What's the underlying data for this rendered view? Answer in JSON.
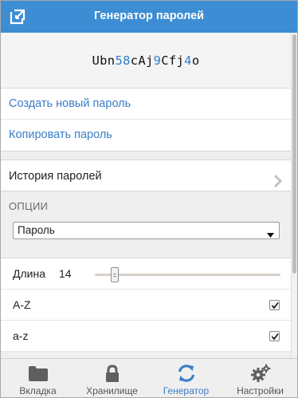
{
  "header": {
    "title": "Генератор паролей",
    "popout_icon": "popout-icon"
  },
  "password": {
    "parts": [
      {
        "text": "Ubn",
        "type": "char"
      },
      {
        "text": "58",
        "type": "digit"
      },
      {
        "text": "cAj",
        "type": "char"
      },
      {
        "text": "9",
        "type": "digit"
      },
      {
        "text": "Cfj",
        "type": "char"
      },
      {
        "text": "4",
        "type": "digit"
      },
      {
        "text": "o",
        "type": "char"
      }
    ],
    "digit_color": "#2f7ed0"
  },
  "actions": {
    "create": "Создать новый пароль",
    "copy": "Копировать пароль"
  },
  "history": {
    "label": "История паролей",
    "icon": "chevron-right-icon"
  },
  "options": {
    "heading": "ОПЦИИ",
    "type_select": {
      "value": "Пароль"
    },
    "length": {
      "label": "Длина",
      "value": "14",
      "slider_fraction": 0.09
    },
    "uppercase": {
      "label": "A-Z",
      "checked": true
    },
    "lowercase": {
      "label": "a-z",
      "checked": true
    }
  },
  "tabs": [
    {
      "label": "Вкладка",
      "icon": "folder-icon",
      "active": false
    },
    {
      "label": "Хранилище",
      "icon": "lock-icon",
      "active": false
    },
    {
      "label": "Генератор",
      "icon": "refresh-icon",
      "active": true
    },
    {
      "label": "Настройки",
      "icon": "gears-icon",
      "active": false
    }
  ],
  "colors": {
    "accent": "#3c8dd3",
    "link": "#3a7ec6",
    "active_tab": "#3b7fc4"
  }
}
